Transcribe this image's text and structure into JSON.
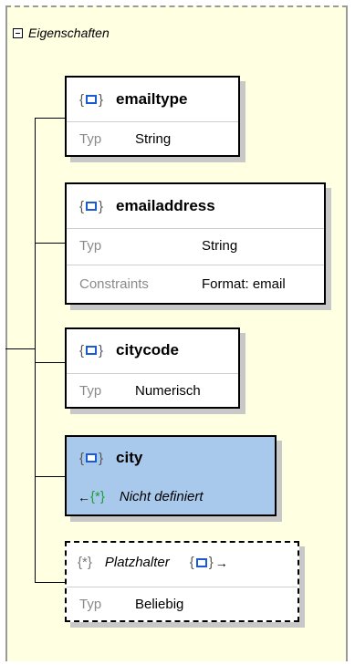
{
  "group": {
    "label": "Eigenschaften",
    "toggle_icon": "collapse-minus-icon"
  },
  "cards": [
    {
      "title": "emailtype",
      "icon": "element-icon",
      "props": [
        {
          "label": "Typ",
          "value": "String"
        }
      ]
    },
    {
      "title": "emailaddress",
      "icon": "element-icon",
      "props": [
        {
          "label": "Typ",
          "value": "String"
        },
        {
          "label": "Constraints",
          "value": "Format: email"
        }
      ]
    },
    {
      "title": "citycode",
      "icon": "element-icon",
      "props": [
        {
          "label": "Typ",
          "value": "Numerisch"
        }
      ]
    },
    {
      "title": "city",
      "icon": "element-icon",
      "selected": true,
      "reference": "Nicht definiert",
      "reference_icon": "wildcard-green-icon"
    },
    {
      "title": "Platzhalter",
      "icon": "wildcard-icon",
      "dashed": true,
      "props": [
        {
          "label": "Typ",
          "value": "Beliebig"
        }
      ]
    }
  ],
  "colors": {
    "panel_bg": "#ffffe2",
    "selected_bg": "#a9c9ec",
    "element_icon": "#1a5ad6",
    "wildcard_green": "#1e9e3a"
  }
}
